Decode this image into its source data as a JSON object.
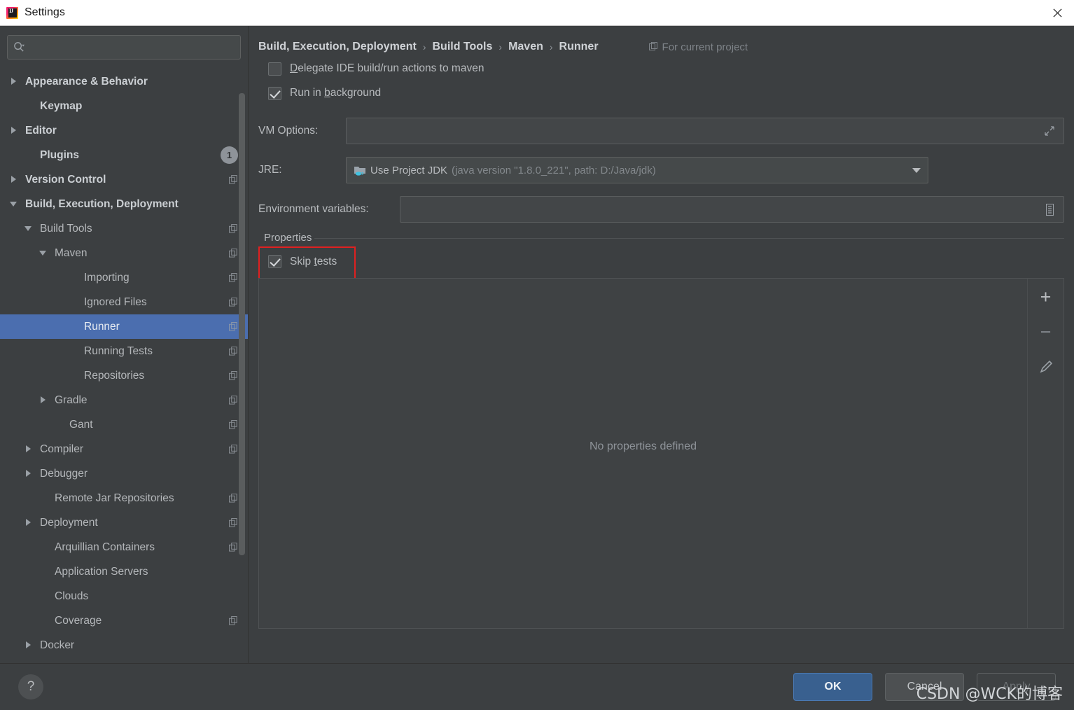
{
  "window": {
    "title": "Settings",
    "app_icon": "intellij-idea-icon",
    "close_icon": "close-icon"
  },
  "search": {
    "value": "",
    "placeholder": "",
    "icon": "search-icon"
  },
  "sidebar": {
    "items": [
      {
        "label": "Appearance & Behavior",
        "indent": 0,
        "arrow": "right",
        "bold": true,
        "copy": false,
        "badge": null,
        "selected": false
      },
      {
        "label": "Keymap",
        "indent": 1,
        "arrow": "none",
        "bold": true,
        "copy": false,
        "badge": null,
        "selected": false
      },
      {
        "label": "Editor",
        "indent": 0,
        "arrow": "right",
        "bold": true,
        "copy": false,
        "badge": null,
        "selected": false
      },
      {
        "label": "Plugins",
        "indent": 1,
        "arrow": "none",
        "bold": true,
        "copy": false,
        "badge": "1",
        "selected": false
      },
      {
        "label": "Version Control",
        "indent": 0,
        "arrow": "right",
        "bold": true,
        "copy": true,
        "badge": null,
        "selected": false
      },
      {
        "label": "Build, Execution, Deployment",
        "indent": 0,
        "arrow": "down",
        "bold": true,
        "copy": false,
        "badge": null,
        "selected": false
      },
      {
        "label": "Build Tools",
        "indent": 1,
        "arrow": "down",
        "bold": false,
        "copy": true,
        "badge": null,
        "selected": false
      },
      {
        "label": "Maven",
        "indent": 2,
        "arrow": "down",
        "bold": false,
        "copy": true,
        "badge": null,
        "selected": false
      },
      {
        "label": "Importing",
        "indent": 4,
        "arrow": "none",
        "bold": false,
        "copy": true,
        "badge": null,
        "selected": false
      },
      {
        "label": "Ignored Files",
        "indent": 4,
        "arrow": "none",
        "bold": false,
        "copy": true,
        "badge": null,
        "selected": false
      },
      {
        "label": "Runner",
        "indent": 4,
        "arrow": "none",
        "bold": false,
        "copy": true,
        "badge": null,
        "selected": true
      },
      {
        "label": "Running Tests",
        "indent": 4,
        "arrow": "none",
        "bold": false,
        "copy": true,
        "badge": null,
        "selected": false
      },
      {
        "label": "Repositories",
        "indent": 4,
        "arrow": "none",
        "bold": false,
        "copy": true,
        "badge": null,
        "selected": false
      },
      {
        "label": "Gradle",
        "indent": 2,
        "arrow": "right",
        "bold": false,
        "copy": true,
        "badge": null,
        "selected": false
      },
      {
        "label": "Gant",
        "indent": 3,
        "arrow": "none",
        "bold": false,
        "copy": true,
        "badge": null,
        "selected": false
      },
      {
        "label": "Compiler",
        "indent": 1,
        "arrow": "right",
        "bold": false,
        "copy": true,
        "badge": null,
        "selected": false
      },
      {
        "label": "Debugger",
        "indent": 1,
        "arrow": "right",
        "bold": false,
        "copy": false,
        "badge": null,
        "selected": false
      },
      {
        "label": "Remote Jar Repositories",
        "indent": 2,
        "arrow": "none",
        "bold": false,
        "copy": true,
        "badge": null,
        "selected": false
      },
      {
        "label": "Deployment",
        "indent": 1,
        "arrow": "right",
        "bold": false,
        "copy": true,
        "badge": null,
        "selected": false
      },
      {
        "label": "Arquillian Containers",
        "indent": 2,
        "arrow": "none",
        "bold": false,
        "copy": true,
        "badge": null,
        "selected": false
      },
      {
        "label": "Application Servers",
        "indent": 2,
        "arrow": "none",
        "bold": false,
        "copy": false,
        "badge": null,
        "selected": false
      },
      {
        "label": "Clouds",
        "indent": 2,
        "arrow": "none",
        "bold": false,
        "copy": false,
        "badge": null,
        "selected": false
      },
      {
        "label": "Coverage",
        "indent": 2,
        "arrow": "none",
        "bold": false,
        "copy": true,
        "badge": null,
        "selected": false
      },
      {
        "label": "Docker",
        "indent": 1,
        "arrow": "right",
        "bold": false,
        "copy": false,
        "badge": null,
        "selected": false
      }
    ]
  },
  "breadcrumb": {
    "parts": [
      "Build, Execution, Deployment",
      "Build Tools",
      "Maven",
      "Runner"
    ],
    "separator": "›",
    "scope_label": "For current project",
    "scope_icon": "copy-icon"
  },
  "options": {
    "delegate": {
      "label_prefix": "D",
      "label_rest": "elegate IDE build/run actions to maven",
      "checked": false
    },
    "background": {
      "label_prefix": "Run in ",
      "label_mid": "b",
      "label_rest": "ackground",
      "checked": true
    }
  },
  "form": {
    "vm_options": {
      "label": "VM Options:",
      "value": "",
      "expand_icon": "expand-arrows-icon"
    },
    "jre": {
      "label": "JRE:",
      "icon": "jdk-folder-icon",
      "value": "Use Project JDK",
      "detail": "(java version \"1.8.0_221\", path: D:/Java/jdk)",
      "arrow_icon": "chevron-down-icon"
    },
    "env_vars": {
      "label": "Environment variables:",
      "value": "",
      "browse_icon": "list-icon"
    }
  },
  "properties": {
    "legend": "Properties",
    "skip_tests": {
      "label_prefix": "Skip ",
      "label_mid": "t",
      "label_rest": "ests",
      "checked": true
    },
    "empty_text": "No properties defined",
    "toolbar": [
      {
        "name": "add-property-button",
        "glyph": "+"
      },
      {
        "name": "remove-property-button",
        "glyph": "−"
      },
      {
        "name": "edit-property-button",
        "glyph": "pencil"
      }
    ],
    "annotation_color": "#e02020"
  },
  "footer": {
    "help_icon": "question-mark-icon",
    "ok": "OK",
    "cancel": "Cancel",
    "apply": "Apply"
  },
  "watermark": "CSDN @WCK的博客",
  "colors": {
    "background": "#3c3f41",
    "selection": "#4b6eaf",
    "primary_button": "#39608f",
    "text": "#b8bbbe",
    "annotation": "#e02020"
  }
}
